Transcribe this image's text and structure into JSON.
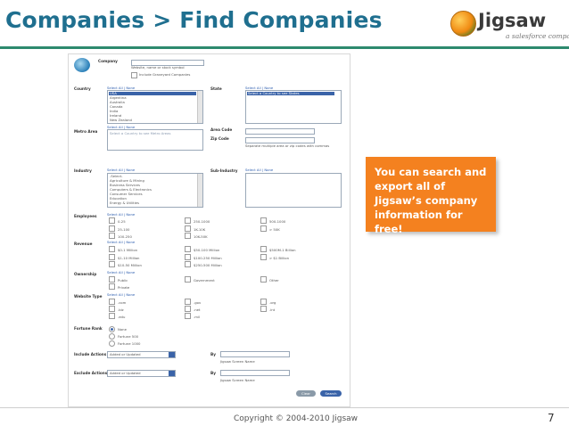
{
  "slide": {
    "title": "Companies > Find Companies",
    "callout": "You can search and export all of Jigsaw’s company information for free!",
    "copyright": "Copyright © 2004-2010 Jigsaw",
    "page_number": "7"
  },
  "logo": {
    "wordmark": "Jigsaw",
    "tagline": "a salesforce company"
  },
  "form": {
    "company": {
      "label": "Company",
      "hint": "Website, name or stock symbol",
      "checkbox_label": "Include Graveyard Companies"
    },
    "select_all_none": "Select All | None",
    "country": {
      "label": "Country",
      "options": [
        "USA",
        "Argentina",
        "Australia",
        "Canada",
        "India",
        "Ireland",
        "New Zealand"
      ],
      "selected": "USA"
    },
    "state": {
      "label": "State",
      "placeholder": "Select a Country to see States"
    },
    "metro_area": {
      "label": "Metro Area",
      "placeholder": "Select a Country to see Metro Areas"
    },
    "area_code": {
      "label": "Area Code"
    },
    "zip_code": {
      "label": "Zip Code",
      "hint": "Separate multiple area or zip codes with commas"
    },
    "industry": {
      "label": "Industry",
      "options": [
        "-Select-",
        "Agriculture & Mining",
        "Business Services",
        "Computers & Electronics",
        "Consumer Services",
        "Education",
        "Energy & Utilities"
      ]
    },
    "sub_industry": {
      "label": "Sub-Industry"
    },
    "employees": {
      "label": "Employees",
      "options": [
        "0-25",
        "25-100",
        "100-250",
        "250-1000",
        "1K-10K",
        "10K-50K",
        "500-1000",
        "> 50K"
      ]
    },
    "revenue": {
      "label": "Revenue",
      "options": [
        "$0-1 Million",
        "$1-10 Million",
        "$10-50 Million",
        "$50-100 Million",
        "$100-250 Million",
        "$250-500 Million",
        "$500M-1 Billion",
        "> $1 Billion"
      ]
    },
    "ownership": {
      "label": "Ownership",
      "options": [
        "Public",
        "Private",
        "Government",
        "Other"
      ]
    },
    "website_type": {
      "label": "Website Type",
      "options": [
        ".com",
        ".biz",
        ".edu",
        ".gov",
        ".net",
        ".mil",
        ".org",
        ".int"
      ]
    },
    "fortune_rank": {
      "label": "Fortune Rank",
      "options": [
        "None",
        "Fortune 500",
        "Fortune 1000"
      ]
    },
    "include_actions": {
      "label": "Include Actions",
      "value": "Added or Updated",
      "by_label": "By",
      "by_hint": "Jigsaw Screen Name"
    },
    "exclude_actions": {
      "label": "Exclude Actions",
      "value": "Added or Updated",
      "by_label": "By",
      "by_hint": "Jigsaw Screen Name"
    },
    "buttons": {
      "clear": "Clear",
      "search": "Search"
    }
  },
  "colors": {
    "title": "#1f6f8f",
    "callout": "#f4811f",
    "accent": "#3a63a8"
  }
}
